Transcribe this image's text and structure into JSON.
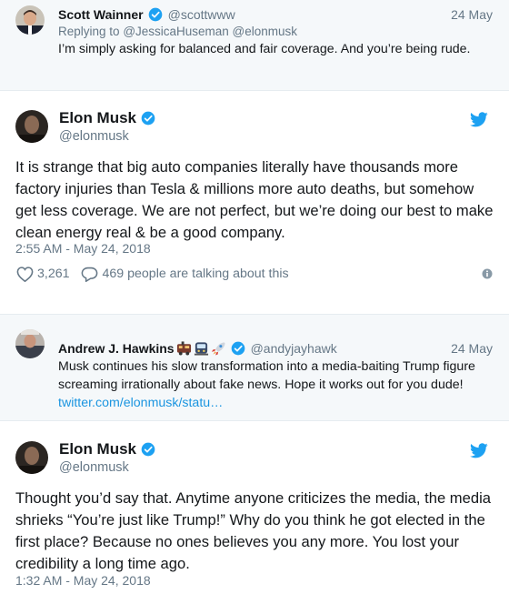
{
  "reply1": {
    "name": "Scott Wainner",
    "handle": "@scottwww",
    "date": "24 May",
    "replying_prefix": "Replying to",
    "mentions": "@JessicaHuseman @elonmusk",
    "text": "I’m simply asking for balanced and fair coverage. And you’re being rude."
  },
  "tweet1": {
    "name": "Elon Musk",
    "handle": "@elonmusk",
    "text": "It is strange that big auto companies literally have thousands more factory injuries than Tesla & millions more auto deaths, but somehow get less coverage. We are not perfect, but we’re doing our best to make clean energy real & be a good company.",
    "timestamp": "2:55 AM - May 24, 2018",
    "likes": "3,261",
    "talking": "469 people are talking about this"
  },
  "reply2": {
    "name": "Andrew J. Hawkins",
    "emojis": [
      "train-emoji",
      "metro-emoji",
      "rocket-emoji"
    ],
    "handle": "@andyjayhawk",
    "date": "24 May",
    "text": "Musk continues his slow transformation into a media-baiting Trump figure screaming irrationally about fake news. Hope it works out for you dude!",
    "link": "twitter.com/elonmusk/statu…"
  },
  "tweet2": {
    "name": "Elon Musk",
    "handle": "@elonmusk",
    "text": "Thought you’d say that. Anytime anyone criticizes the media, the media shrieks “You’re just like Trump!” Why do you think he got elected in the first place? Because no ones believes you any more. You lost your credibility a long time ago.",
    "timestamp": "1:32 AM - May 24, 2018"
  },
  "colors": {
    "verified_blue": "#1da1f2",
    "link_blue": "#1b95e0",
    "muted_gray": "#657786",
    "reply_bg": "#f5f8fa"
  }
}
